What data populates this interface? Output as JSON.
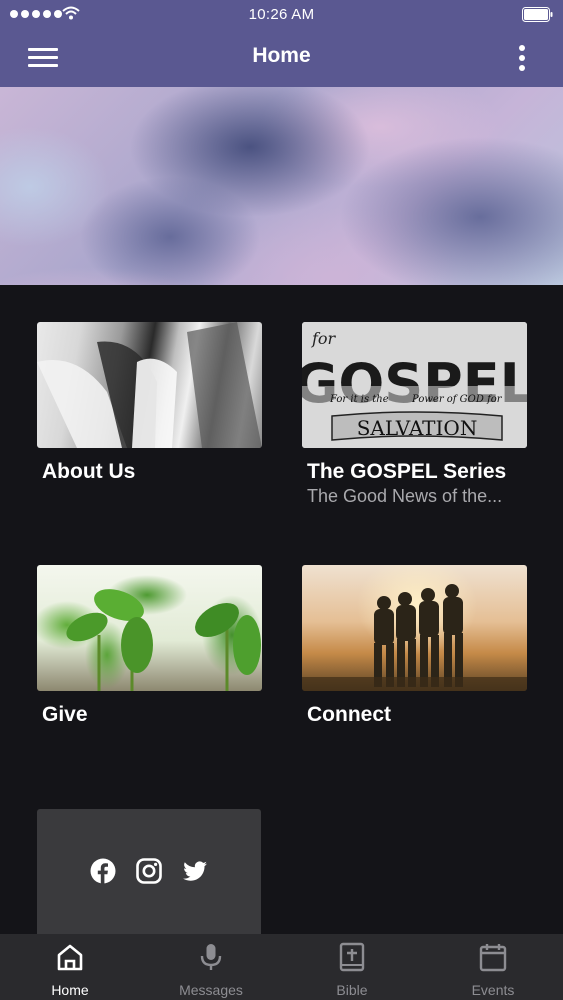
{
  "status_bar": {
    "time": "10:26 AM"
  },
  "nav": {
    "title": "Home",
    "menu_icon": "hamburger-menu-icon",
    "more_icon": "more-vertical-icon"
  },
  "hero": {
    "image": "cloudy-pastel-sky"
  },
  "cards": [
    {
      "title": "About Us",
      "subtitle": "",
      "image": "clasped-hands-photo"
    },
    {
      "title": "The GOSPEL Series",
      "subtitle": "The Good News of the...",
      "image": "gospel-lettering-artwork",
      "artwork_text": {
        "top": "for",
        "heading": "GOSPEL",
        "mid_left": "For it is the",
        "mid_right": "Power of GOD for",
        "bottom": "SALVATION"
      }
    },
    {
      "title": "Give",
      "subtitle": "",
      "image": "seedlings-photo"
    },
    {
      "title": "Connect",
      "subtitle": "",
      "image": "friends-sunset-photo"
    }
  ],
  "social": {
    "icons": [
      "facebook-icon",
      "instagram-icon",
      "twitter-icon"
    ]
  },
  "tab_bar": {
    "items": [
      {
        "label": "Home",
        "icon": "home-icon",
        "active": true
      },
      {
        "label": "Messages",
        "icon": "microphone-icon",
        "active": false
      },
      {
        "label": "Bible",
        "icon": "bible-icon",
        "active": false
      },
      {
        "label": "Events",
        "icon": "calendar-icon",
        "active": false
      }
    ]
  },
  "colors": {
    "header": "#5a5891",
    "background": "#141418",
    "tab_bar": "#2a2a2d",
    "tab_inactive": "#8d8d92",
    "subtitle": "#a9a9ad",
    "social_box": "#3a3a3d"
  }
}
